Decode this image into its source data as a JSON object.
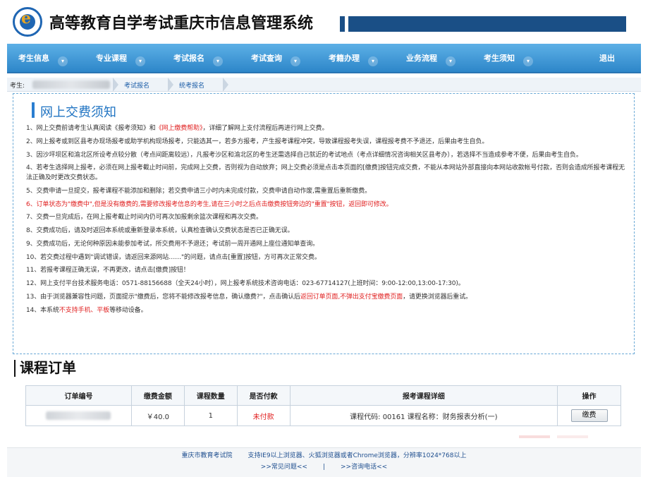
{
  "header": {
    "title": "高等教育自学考试重庆市信息管理系统",
    "logo_icon": "exam-logo-icon"
  },
  "nav": {
    "items": [
      {
        "label": "考生信息"
      },
      {
        "label": "专业课程"
      },
      {
        "label": "考试报名"
      },
      {
        "label": "考试查询"
      },
      {
        "label": "考籍办理"
      },
      {
        "label": "业务流程"
      },
      {
        "label": "考生须知"
      }
    ],
    "logout": "退出"
  },
  "breadcrumb": {
    "prefix": "考生:",
    "items": [
      "考试报名",
      "统考报名"
    ]
  },
  "notice": {
    "title": "网上交费须知",
    "lines": {
      "l1a": "1、网上交费前请考生认真阅读《报考须知》和",
      "l1b": "《网上缴费帮助》",
      "l1c": "，详细了解网上支付流程后再进行网上交费。",
      "l2": "2、网上报考或到区县考办现场报考或助学机构现场报考，只能选其一，若多方报考，产生报考课程冲突，导致课程报考失误，课程报考费不予退还，后果由考生自负。",
      "l3": "3、因沙坪坝区和渝北区所设考点较分散（考点间距离较远），凡报考沙区和渝北区的考生还需选择自己就近的考试地点（考点详细情况咨询相关区县考办），若选择不当造成参考不便，后果由考生自负。",
      "l4": "4、若考生选择网上报考，必须在网上报考截止时间前，完成网上交费，否则视为自动放弃；网上交费必须是点击本页面的[缴费]按钮完成交费，不能从本网站外部直接向本网站收款帐号付款，否则会造成所报考课程无法正确及时更改交费状态。",
      "l5": "5、交费申请一旦提交，报考课程不能添加和删除；若交费申请三小时内未完成付款，交费申请自动作废,需重置后重新缴费。",
      "l6": "6、订单状态为\"缴费中\",但是没有缴费的,需要修改报考信息的考生,请在三小时之后点击缴费按钮旁边的\"重置\"按钮，返回即可修改。",
      "l7": "7、交费一旦完成后，在网上报考截止时间内仍可再次加报剩余篮次课程和再次交费。",
      "l8": "8、交费成功后，请及时返回本系统或重新登录本系统，认真检查确认交费状态是否已正确无误。",
      "l9": "9、交费成功后，无论何种原因未能参加考试，所交费用不予退还；考试前一周开通网上座位通知单查询。",
      "l10": "10、若交费过程中遇到\"调试错误，请返回来源网站……\"的问题，请点击[重置]按钮，方可再次正常交费。",
      "l11": "11、若报考课程正确无误，不再更改，请点击[缴费]按钮！",
      "l12": "12、网上支付平台技术服务电话：0571-88156688（全天24小时），网上报考系统技术咨询电话：023-67714127(上班时间：9:00-12:00,13:00-17:30)。",
      "l13a": "13、由于浏览器兼容性问题，页面提示\"缴费后，您将不能修改报考信息，确认缴费?\"，点击确认后",
      "l13b": "返回订单页面,不弹出支付宝缴费页面",
      "l13c": "，请更换浏览器后重试。",
      "l14a": "14、本系统",
      "l14b": "不支持手机、平板",
      "l14c": "等移动设备。"
    }
  },
  "orders": {
    "title": "课程订单",
    "columns": [
      "订单编号",
      "缴费金额",
      "课程数量",
      "是否付款",
      "报考课程详细",
      "操作"
    ],
    "rows": [
      {
        "amount": "￥40.0",
        "count": "1",
        "paid": "未付款",
        "detail": "课程代码: 00161   课程名称：财务报表分析(一)",
        "action": "缴费"
      }
    ]
  },
  "footer": {
    "org": "重庆市教育考试院",
    "browser_note": "支持IE9以上浏览器、火狐浏览器或者Chrome浏览器，分辨率1024*768以上",
    "faq": ">>常见问题<<",
    "divider": "|",
    "contact": ">>咨询电话<<"
  }
}
